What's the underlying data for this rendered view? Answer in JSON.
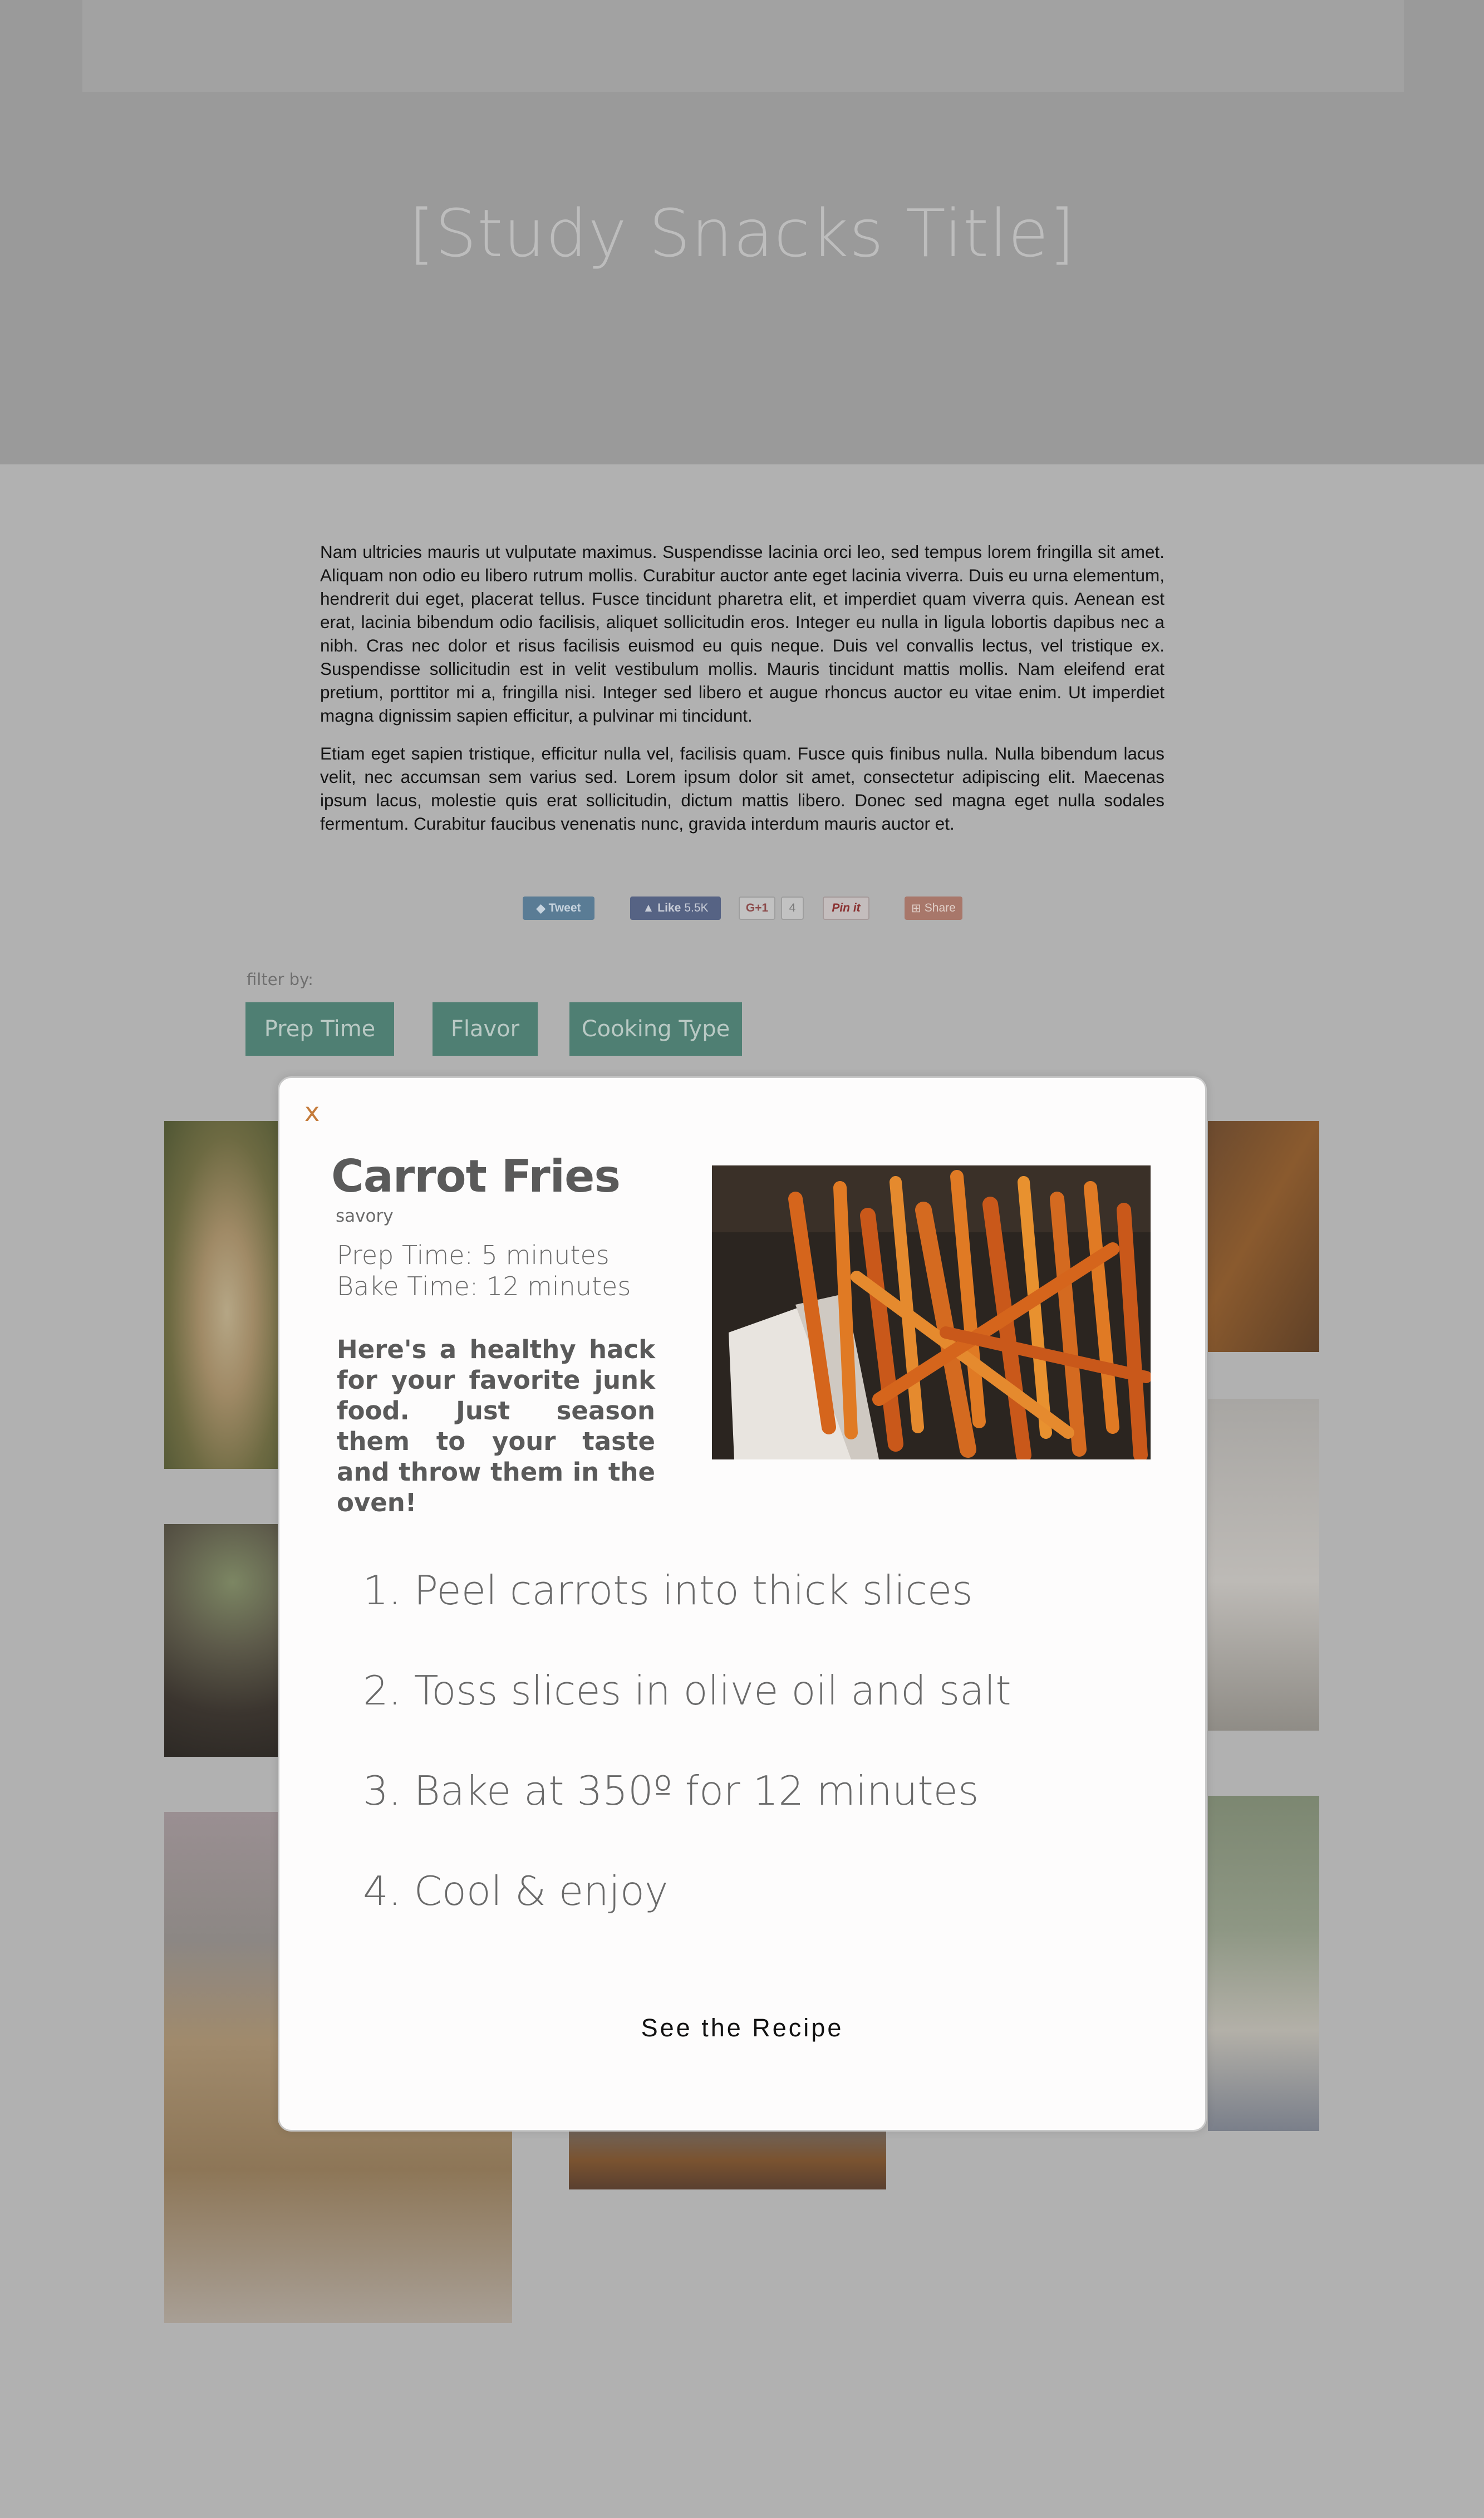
{
  "hero": {
    "title": "[Study Snacks Title]"
  },
  "intro": {
    "paragraphs": [
      "Nam ultricies mauris ut vulputate maximus. Suspendisse lacinia orci leo, sed tempus lorem fringilla sit amet. Aliquam non odio eu libero rutrum mollis. Curabitur auctor ante eget lacinia viverra. Duis eu urna elementum, hendrerit dui eget, placerat tellus. Fusce tincidunt pharetra elit, et imperdiet quam viverra quis. Aenean est erat, lacinia bibendum odio facilisis, aliquet sollicitudin eros. Integer eu nulla in ligula lobortis dapibus nec a nibh. Cras nec dolor et risus facilisis euismod eu quis neque. Duis vel convallis lectus, vel tristique ex. Suspendisse sollicitudin est in velit vestibulum mollis. Mauris tincidunt mattis mollis. Nam eleifend erat pretium, porttitor mi a, fringilla nisi. Integer sed libero et augue rhoncus auctor eu vitae enim. Ut imperdiet magna dignissim sapien efficitur, a pulvinar mi tincidunt.",
      "Etiam eget sapien tristique, efficitur nulla vel, facilisis quam. Fusce quis finibus nulla. Nulla bibendum lacus velit, nec accumsan sem varius sed. Lorem ipsum dolor sit amet, consectetur adipiscing elit. Maecenas ipsum lacus, molestie quis erat sollicitudin, dictum mattis libero. Donec sed magna eget nulla sodales fermentum. Curabitur faucibus venenatis nunc, gravida interdum mauris auctor et."
    ]
  },
  "share": {
    "tweet": "Tweet",
    "like": "Like",
    "like_count": "5.5K",
    "gplus": "G+1",
    "gplus_count": "4",
    "pinit": "Pin it",
    "share": "Share"
  },
  "filters": {
    "label": "filter by:",
    "buttons": [
      "Prep Time",
      "Flavor",
      "Cooking Type"
    ]
  },
  "modal": {
    "close": "x",
    "title": "Carrot Fries",
    "category": "savory",
    "prep_time": "Prep Time: 5 minutes",
    "bake_time": "Bake Time: 12 minutes",
    "description": "Here's a healthy hack for your favorite junk food. Just season them to your taste and throw them in the oven!",
    "steps": [
      "1. Peel carrots into thick slices",
      "2. Toss slices in olive oil and salt",
      "3. Bake at 350º for 12 minutes",
      "4. Cool & enjoy"
    ],
    "cta": "See the Recipe"
  },
  "colors": {
    "overlay_bg": "#b1b1b1",
    "filter_button": "#4f7f73",
    "close_accent": "#c57c3c"
  }
}
